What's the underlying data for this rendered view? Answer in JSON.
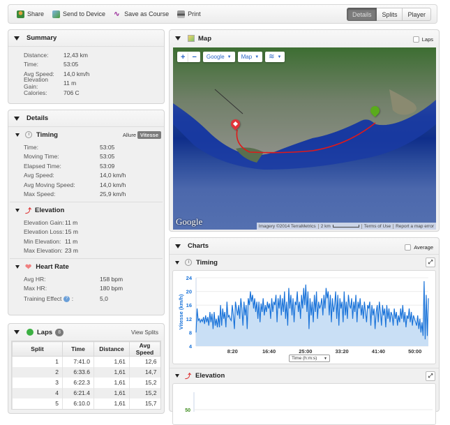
{
  "toolbar": {
    "share": "Share",
    "send_to_device": "Send to Device",
    "save_as_course": "Save as Course",
    "print": "Print",
    "tabs": [
      "Details",
      "Splits",
      "Player"
    ],
    "active_tab": "Details"
  },
  "summary": {
    "title": "Summary",
    "rows": [
      {
        "label": "Distance:",
        "value": "12,43 km"
      },
      {
        "label": "Time:",
        "value": "53:05"
      },
      {
        "label": "Avg Speed:",
        "value": "14,0 km/h"
      },
      {
        "label": "Elevation Gain:",
        "value": "11 m"
      },
      {
        "label": "Calories:",
        "value": "706 C"
      }
    ]
  },
  "details": {
    "title": "Details",
    "timing": {
      "title": "Timing",
      "toggle": [
        "Allure",
        "Vitesse"
      ],
      "active_toggle": "Vitesse",
      "rows": [
        {
          "label": "Time:",
          "value": "53:05"
        },
        {
          "label": "Moving Time:",
          "value": "53:05"
        },
        {
          "label": "Elapsed Time:",
          "value": "53:09"
        },
        {
          "label": "Avg Speed:",
          "value": "14,0 km/h"
        },
        {
          "label": "Avg Moving Speed:",
          "value": "14,0 km/h"
        },
        {
          "label": "Max Speed:",
          "value": "25,9 km/h"
        }
      ]
    },
    "elevation": {
      "title": "Elevation",
      "rows": [
        {
          "label": "Elevation Gain:",
          "value": "11 m"
        },
        {
          "label": "Elevation Loss:",
          "value": "15 m"
        },
        {
          "label": "Min Elevation:",
          "value": "11 m"
        },
        {
          "label": "Max Elevation:",
          "value": "23 m"
        }
      ]
    },
    "heart_rate": {
      "title": "Heart Rate",
      "rows": [
        {
          "label": "Avg HR:",
          "value": "158 bpm"
        },
        {
          "label": "Max HR:",
          "value": "180 bpm"
        },
        {
          "label": "Training Effect",
          "value": "5,0"
        }
      ]
    }
  },
  "laps": {
    "title": "Laps",
    "count": "8",
    "view_splits": "View Splits",
    "columns": [
      "Split",
      "Time",
      "Distance",
      "Avg Speed"
    ],
    "rows": [
      [
        "1",
        "7:41.0",
        "1,61",
        "12,6"
      ],
      [
        "2",
        "6:33.6",
        "1,61",
        "14,7"
      ],
      [
        "3",
        "6:22.3",
        "1,61",
        "15,2"
      ],
      [
        "4",
        "6:21.4",
        "1,61",
        "15,2"
      ],
      [
        "5",
        "6:10.0",
        "1,61",
        "15,7"
      ]
    ]
  },
  "map": {
    "title": "Map",
    "laps_label": "Laps",
    "zoom_in": "+",
    "zoom_out": "−",
    "provider": "Google",
    "map_type": "Map",
    "logo": "Google",
    "attribution": "Imagery ©2014 TerraMetrics",
    "scale": "2 km",
    "terms": "Terms of Use",
    "report": "Report a map error"
  },
  "charts": {
    "title": "Charts",
    "average_label": "Average",
    "timing_title": "Timing",
    "elevation_title": "Elevation",
    "x_selector": "Time (h:m:s)"
  },
  "chart_data": [
    {
      "type": "area",
      "title": "Timing",
      "ylabel": "Vitesse (km/h)",
      "xlabel": "Time (h:m:s)",
      "ylim": [
        4,
        24
      ],
      "yticks": [
        "4",
        "8",
        "12",
        "16",
        "20",
        "24"
      ],
      "xticks": [
        "8:20",
        "16:40",
        "25:00",
        "33:20",
        "41:40",
        "50:00"
      ],
      "x_range_min": [
        0,
        53.08
      ],
      "color": "#1a73d9",
      "fill": "#c9dff5",
      "values": [
        8,
        15,
        11.5,
        12,
        11,
        11.8,
        11.2,
        12.5,
        10.5,
        13,
        11,
        12.5,
        10,
        14,
        11,
        13.5,
        9,
        14,
        10,
        12,
        9.5,
        13,
        9.5,
        16,
        10,
        15,
        12,
        14,
        9.5,
        17,
        12.5,
        13,
        12,
        11.5,
        16,
        13,
        9,
        17,
        15,
        13,
        16,
        12,
        18,
        15,
        10,
        17,
        13,
        16,
        9,
        18,
        16,
        20,
        17,
        19,
        15,
        18,
        14,
        17,
        12,
        17,
        11,
        16.5,
        14,
        18,
        13,
        16,
        14,
        17,
        15,
        16.5,
        12,
        18,
        14,
        17,
        16,
        19,
        11,
        18,
        15,
        19,
        13,
        18,
        14,
        20,
        12,
        17,
        10,
        21,
        15,
        19,
        13,
        18,
        11,
        17,
        16,
        20,
        14,
        17,
        12,
        19,
        15,
        21,
        16,
        22,
        14,
        20,
        9,
        18,
        13,
        17,
        11,
        19,
        14,
        20,
        12,
        17,
        15,
        16,
        18,
        13,
        19,
        15,
        21,
        18,
        20,
        13,
        19,
        11,
        18,
        14,
        16,
        20,
        12,
        19,
        10,
        18,
        15,
        17,
        11,
        20,
        13,
        17,
        12,
        19,
        16,
        15,
        18,
        12,
        17,
        14,
        19,
        11,
        17,
        15,
        18,
        13,
        16,
        12,
        17,
        14,
        11,
        16,
        15,
        17,
        10,
        16,
        13,
        15,
        9,
        14,
        16,
        11,
        17,
        14,
        10,
        16,
        13,
        15,
        9.5,
        16,
        12,
        15,
        11,
        14,
        13,
        10,
        15,
        12,
        14,
        10,
        13,
        11,
        15,
        12,
        16,
        11,
        14,
        9.5,
        13,
        12,
        15,
        11,
        14,
        10,
        13,
        12,
        11,
        10,
        13,
        9,
        12,
        8,
        11,
        7,
        23,
        6,
        19,
        7,
        18
      ],
      "grid": true
    },
    {
      "type": "area",
      "title": "Elevation",
      "yticks": [
        "50"
      ],
      "values": []
    }
  ]
}
